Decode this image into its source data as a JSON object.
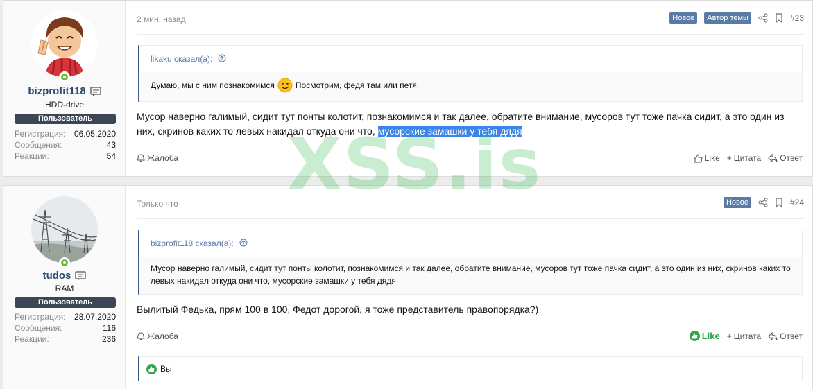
{
  "posts": [
    {
      "user": {
        "name": "bizprofit118",
        "title": "HDD-drive",
        "banner": "Пользователь",
        "stats": [
          {
            "label": "Регистрация:",
            "value": "06.05.2020"
          },
          {
            "label": "Сообщения:",
            "value": "43"
          },
          {
            "label": "Реакции:",
            "value": "54"
          }
        ]
      },
      "date": "2 мин. назад",
      "badges": [
        "Новое",
        "Автор темы"
      ],
      "number": "#23",
      "quote": {
        "author": "likaku сказал(а):",
        "text_before": "Думаю, мы с ним познакомимся",
        "text_after": "Посмотрим, федя там или петя."
      },
      "text": "Мусор наверно галимый, сидит тут понты колотит, познакомимся и так далее, обратите внимание, мусоров тут тоже пачка сидит, а это один из них, скринов каких то левых накидал откуда они что, ",
      "text_highlight": "мусорские замашки у тебя дядя",
      "report": "Жалоба",
      "like": "Like",
      "quote_btn": "Цитата",
      "reply": "Ответ"
    },
    {
      "user": {
        "name": "tudos",
        "title": "RAM",
        "banner": "Пользователь",
        "stats": [
          {
            "label": "Регистрация:",
            "value": "28.07.2020"
          },
          {
            "label": "Сообщения:",
            "value": "116"
          },
          {
            "label": "Реакции:",
            "value": "236"
          }
        ]
      },
      "date": "Только что",
      "badges": [
        "Новое"
      ],
      "number": "#24",
      "quote": {
        "author": "bizprofit118 сказал(а):",
        "text": "Мусор наверно галимый, сидит тут понты колотит, познакомимся и так далее, обратите внимание, мусоров тут тоже пачка сидит, а это один из них, скринов каких то левых накидал откуда они что, мусорские замашки у тебя дядя"
      },
      "text": "Вылитый Федька, прям 100 в 100, Федот дорогой, я тоже представитель правопорядка?)",
      "report": "Жалоба",
      "like": "Like",
      "quote_btn": "Цитата",
      "reply": "Ответ",
      "reaction_text": "Вы"
    }
  ],
  "watermark": "XSS.is",
  "colors": {
    "accent": "#5a7ba6",
    "like_active": "#2fa64a",
    "highlight": "#3b84e8",
    "banner": "#3c4755"
  }
}
